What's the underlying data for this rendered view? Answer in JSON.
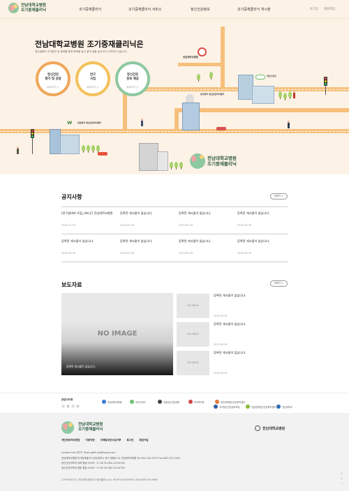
{
  "header": {
    "logo_line1": "전남대학교병원",
    "logo_line2": "조기중재클리닉",
    "nav": [
      "조기중재클리닉",
      "조기중재클리닉 서비스",
      "정신건강정보",
      "조기중재클리닉 게시판"
    ],
    "login": "로그인",
    "join": "회원가입"
  },
  "hero": {
    "title": "전남대학교병원 조기중재클리닉은",
    "subtitle": "정신질환의 조기발견 및 중재를 통해 회복을 돕고 삶의 질을 높이고자 노력하고 있습니다.",
    "circles": [
      {
        "line1": "정신건강",
        "line2": "평가 및 상담",
        "more": "바로가기 >",
        "color": "#f0a65a"
      },
      {
        "line1": "연구",
        "line2": "사업",
        "more": "바로가기 >",
        "color": "#f3c15a"
      },
      {
        "line1": "정신건강",
        "line2": "정보 제공",
        "more": "바로가기 >",
        "color": "#8cc8a0"
      }
    ],
    "sign_hospital": "전남대학교병원",
    "sign_center1": "광주광역 정신건강복지센터",
    "sign_center2": "전남광역 정신건강복지센터",
    "sign_mind": "마인드링크",
    "logo_line1": "전남대학교병원",
    "logo_line2": "조기중재클리닉"
  },
  "notice": {
    "title": "공지사항",
    "more": "더보기 +",
    "items": [
      {
        "title": "[연구참여자 모집_대조군] 전남대학교병원",
        "date": "2025.01.03"
      },
      {
        "title": "등록된 게시물이 없습니다.",
        "date": "2025.09.26"
      },
      {
        "title": "등록된 게시물이 없습니다.",
        "date": "2025.09.26"
      },
      {
        "title": "등록된 게시물이 없습니다.",
        "date": "2025.09.26"
      },
      {
        "title": "등록된 게시물이 없습니다.",
        "date": "2025.09.26"
      },
      {
        "title": "등록된 게시물이 없습니다.",
        "date": "2025.09.26"
      },
      {
        "title": "등록된 게시물이 없습니다.",
        "date": "2025.09.26"
      },
      {
        "title": "등록된 게시물이 없습니다.",
        "date": "2025.09.26"
      }
    ]
  },
  "press": {
    "title": "보도자료",
    "more": "더보기 +",
    "main": {
      "image_text": "NO IMAGE",
      "caption": "등록된 게시물이 없습니다."
    },
    "items": [
      {
        "thumb": "NO IMAGE",
        "title": "등록된 게시물이 없습니다.",
        "date": "2025.09.26"
      },
      {
        "thumb": "NO IMAGE",
        "title": "등록된 게시물이 없습니다.",
        "date": "2025.09.26"
      },
      {
        "thumb": "NO IMAGE",
        "title": "등록된 게시물이 없습니다.",
        "date": "2025.09.26"
      }
    ]
  },
  "family": {
    "label": "관련사이트",
    "controls": [
      "‹",
      "‖",
      "›",
      "+"
    ],
    "partners": [
      {
        "name": "전남대학교병원",
        "color": "#3a7bd5"
      },
      {
        "name": "마인드링크",
        "color": "#6cc070"
      },
      {
        "name": "국립정신건강센터",
        "color": "#444"
      },
      {
        "name": "보건복지부",
        "color": "#c44"
      },
      {
        "name": "국가정신건강정보포털",
        "color": "#2f5fa5"
      },
      {
        "name": "광주광역정신건강복지센터",
        "color": "#e07b39"
      },
      {
        "name": "전남광역정신건강복지센터",
        "color": "#8cb83a"
      },
      {
        "name": "전남대학교",
        "color": "#2b6cb0"
      }
    ]
  },
  "footer": {
    "logo_line1": "전남대학교병원",
    "logo_line2": "조기중재클리닉",
    "hospital": "전남대학교병원",
    "links": [
      "개인정보처리방침",
      "이용약관",
      "이메일무단수집거부",
      "로그인",
      "회원가입"
    ],
    "info": [
      "Contact the GETIT Team getit.net@naver.com",
      "전남대학교병원 조기중재클리닉 광주광역시 동구 제봉로 42 전남대학교병원 Tel.062-220-5270 Fax.062-225-2441",
      "정신건강의학과 외래 평일 09:00~17:30 Tel.062-220-6136",
      "정신건강의학과 병동 평일 09:00~17:30 Tel.062-220-6746"
    ],
    "copyright": "COPYRIGHT(C) 전남대학교병원 조기중재클리닉 ALL RIGHTS RESERVED. DESIGNED BY WEBS"
  }
}
